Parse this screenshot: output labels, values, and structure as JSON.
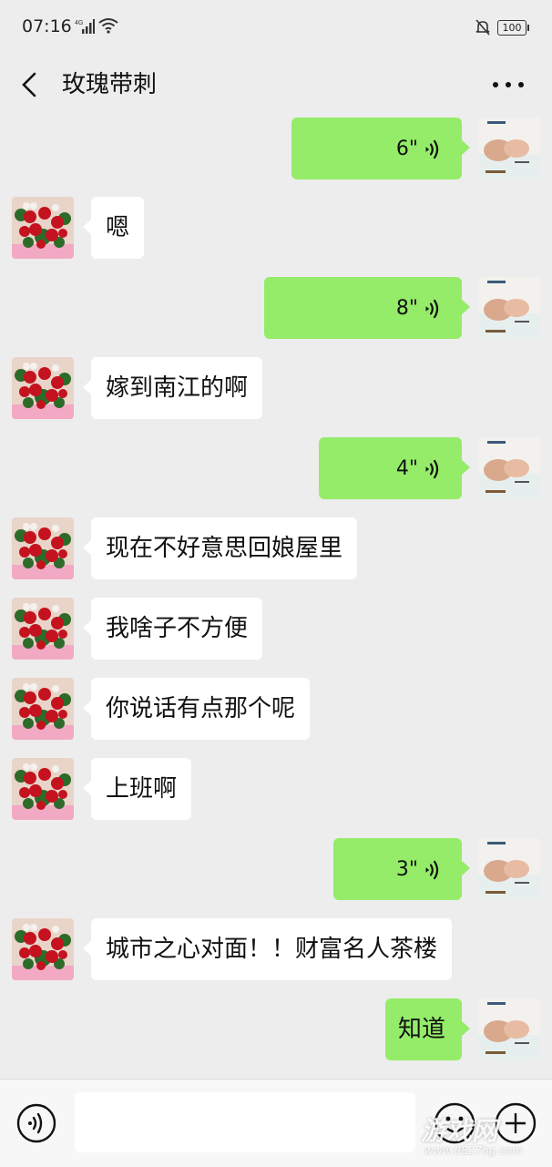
{
  "status_bar": {
    "time": "07:16",
    "network": "4G",
    "battery": "100"
  },
  "header": {
    "title": "玫瑰带刺",
    "back_icon": "chevron-left-icon",
    "more_icon": "more-icon"
  },
  "messages": [
    {
      "dir": "out",
      "type": "voice",
      "duration": "6\""
    },
    {
      "dir": "in",
      "type": "text",
      "text": "嗯"
    },
    {
      "dir": "out",
      "type": "voice",
      "duration": "8\""
    },
    {
      "dir": "in",
      "type": "text",
      "text": "嫁到南江的啊"
    },
    {
      "dir": "out",
      "type": "voice",
      "duration": "4\""
    },
    {
      "dir": "in",
      "type": "text",
      "text": "现在不好意思回娘屋里"
    },
    {
      "dir": "in",
      "type": "text",
      "text": "我啥子不方便"
    },
    {
      "dir": "in",
      "type": "text",
      "text": "你说话有点那个呢"
    },
    {
      "dir": "in",
      "type": "text",
      "text": "上班啊"
    },
    {
      "dir": "out",
      "type": "voice",
      "duration": "3\""
    },
    {
      "dir": "in",
      "type": "text",
      "text": "城市之心对面！！财富名人茶楼"
    },
    {
      "dir": "out",
      "type": "text",
      "text": "知道"
    }
  ],
  "input_bar": {
    "voice_icon": "voice-icon",
    "emoji_icon": "emoji-icon",
    "plus_icon": "plus-icon"
  },
  "watermark": {
    "main": "游戏网",
    "sub": "www.0827hg.com"
  },
  "colors": {
    "bubble_out": "#95ec69",
    "bubble_in": "#ffffff",
    "background": "#ededed"
  }
}
